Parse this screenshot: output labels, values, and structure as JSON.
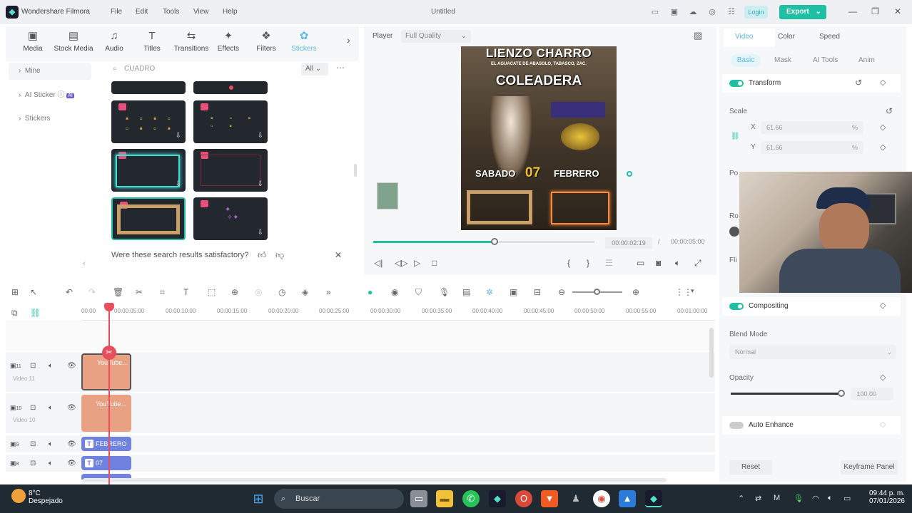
{
  "app": {
    "name": "Wondershare Filmora",
    "doc_title": "Untitled"
  },
  "menu": [
    "File",
    "Edit",
    "Tools",
    "View",
    "Help"
  ],
  "header_buttons": {
    "login": "Login",
    "export": "Export"
  },
  "media_tabs": [
    "Media",
    "Stock Media",
    "Audio",
    "Titles",
    "Transitions",
    "Effects",
    "Filters",
    "Stickers"
  ],
  "active_media_tab": "Stickers",
  "sidebar": [
    "Mine",
    "AI Sticker",
    "Stickers"
  ],
  "search": {
    "value": "CUADRO",
    "filter": "All"
  },
  "feedback": {
    "question": "Were these search results satisfactory?"
  },
  "player": {
    "label": "Player",
    "quality": "Full Quality",
    "current_time": "00:00:02:19",
    "separator": "/",
    "total_time": "00:00:05:00",
    "progress": 0.55
  },
  "poster": {
    "title": "LIENZO CHARRO",
    "location": "EL AGUACATE DE ABASOLO, TABASCO, ZAC.",
    "event": "COLEADERA",
    "day": "SABADO",
    "date": "07",
    "month": "FEBRERO"
  },
  "right_panel": {
    "tabs": [
      "Video",
      "Color",
      "Speed"
    ],
    "subtabs": [
      "Basic",
      "Mask",
      "AI Tools",
      "Anim"
    ],
    "transform": "Transform",
    "scale_label": "Scale",
    "scale_x_label": "X",
    "scale_x": "61.66",
    "scale_y_label": "Y",
    "scale_y": "61.66",
    "unit": "%",
    "position_label": "Po",
    "rotation_label": "Ro",
    "flip_label": "Fli",
    "compositing": "Compositing",
    "blend_mode_label": "Blend Mode",
    "blend_mode": "Normal",
    "opacity_label": "Opacity",
    "opacity": "100.00",
    "opacity_level": 1.0,
    "auto_enhance": "Auto Enhance",
    "reset": "Reset",
    "keyframe_panel": "Keyframe Panel"
  },
  "ruler_ticks": [
    "00:00",
    "00:00:05:00",
    "00:00:10:00",
    "00:00:15:00",
    "00:00:20:00",
    "00:00:25:00",
    "00:00:30:00",
    "00:00:35:00",
    "00:00:40:00",
    "00:00:45:00",
    "00:00:50:00",
    "00:00:55:00",
    "00:01:00:00"
  ],
  "tracks": [
    {
      "num": "11",
      "label": "Video 11",
      "clip": "YouTube..."
    },
    {
      "num": "10",
      "label": "Video 10",
      "clip": "YouTube..."
    },
    {
      "num": "9",
      "label": "",
      "clip": "FEBRERO"
    },
    {
      "num": "8",
      "label": "",
      "clip": "07"
    }
  ],
  "taskbar": {
    "temperature": "8°C",
    "weather": "Despejado",
    "search": "Buscar",
    "time": "09:44 p. m.",
    "date": "07/01/2026"
  },
  "colors": {
    "accent": "#1fbfa4",
    "clip_video": "#e8a183",
    "clip_text": "#6f82e0",
    "playhead": "#e84f5d"
  }
}
